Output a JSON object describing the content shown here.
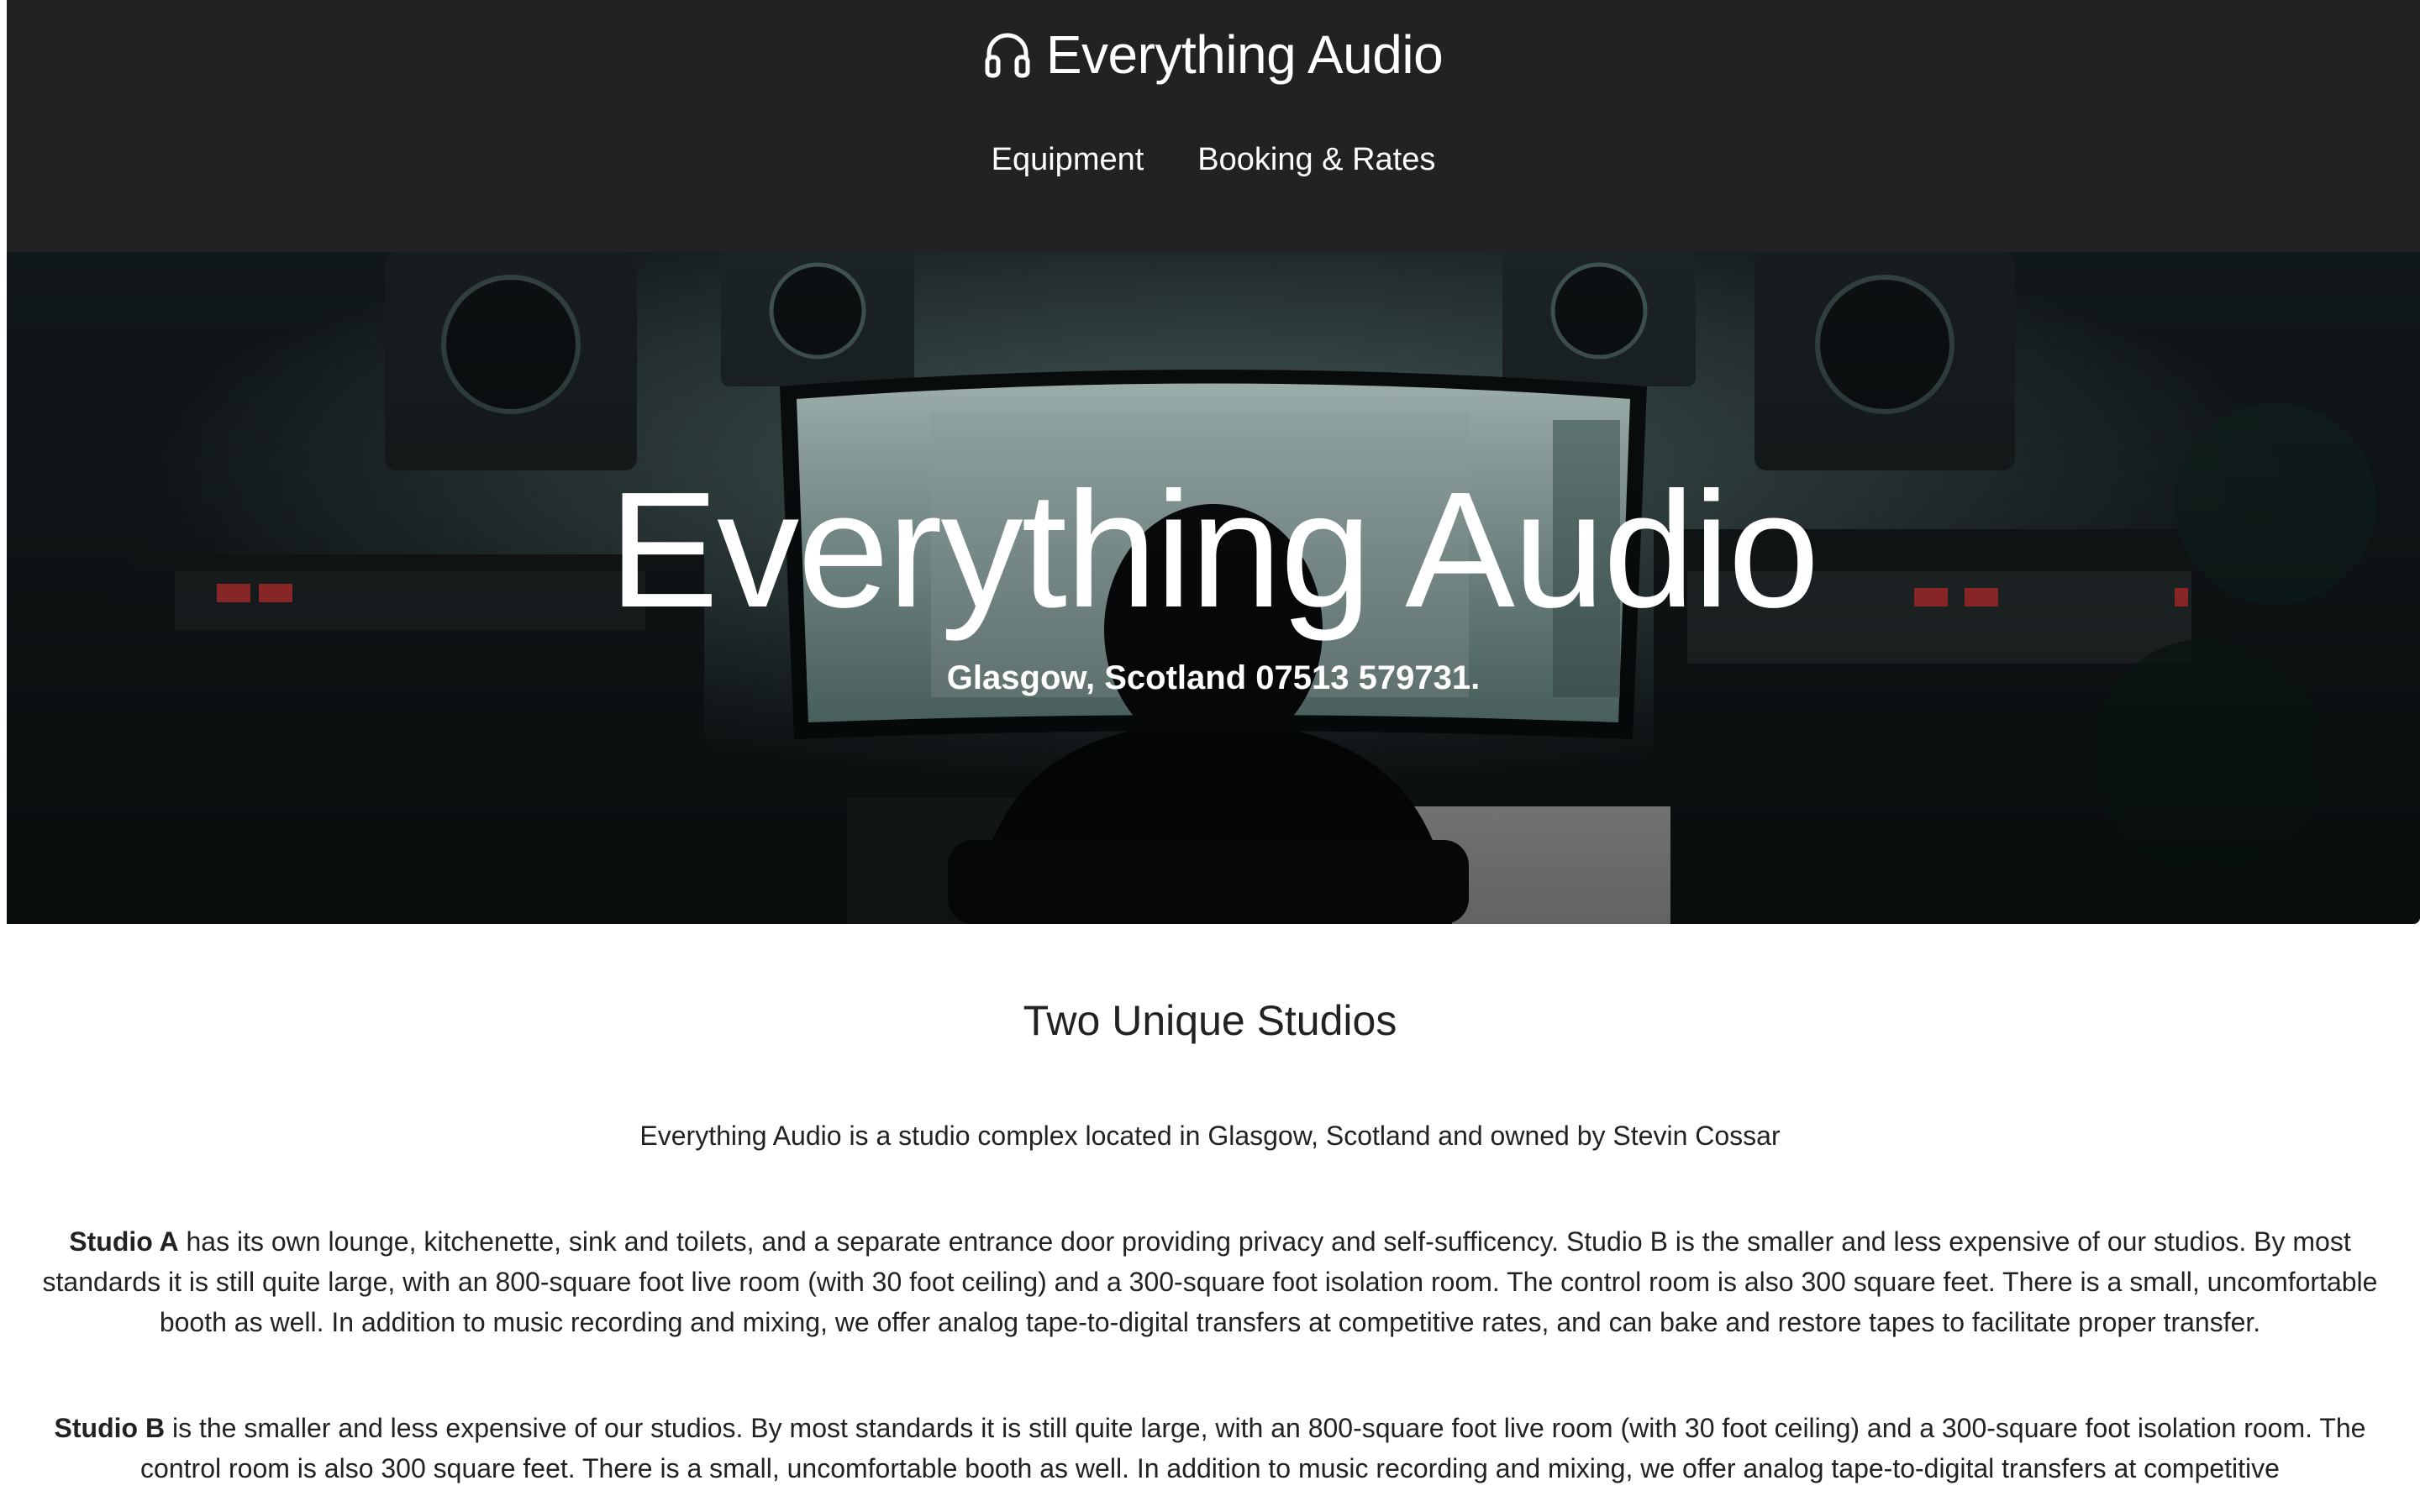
{
  "header": {
    "brand_icon": "headphones-icon",
    "brand_title": "Everything Audio",
    "nav": [
      {
        "label": "Equipment"
      },
      {
        "label": "Booking & Rates"
      }
    ]
  },
  "hero": {
    "title": "Everything Audio",
    "subtitle": "Glasgow, Scotland 07513 579731.",
    "background_description_colors": {
      "accent": "#3a5a58",
      "dark": "#0d1214"
    }
  },
  "main": {
    "section_title": "Two Unique Studios",
    "intro": "Everything Audio is a studio complex located in Glasgow, Scotland and owned by Stevin Cossar",
    "studios": [
      {
        "name": "Studio A",
        "text": " has its own lounge, kitchenette, sink and toilets, and a separate entrance door providing privacy and self-sufficency. Studio B is the smaller and less expensive of our studios. By most standards it is still quite large, with an 800-square foot live room (with 30 foot ceiling) and a 300-square foot isolation room. The control room is also 300 square feet. There is a small, uncomfortable booth as well. In addition to music recording and mixing, we offer analog tape-to-digital transfers at competitive rates, and can bake and restore tapes to facilitate proper transfer."
      },
      {
        "name": "Studio B",
        "text": " is the smaller and less expensive of our studios. By most standards it is still quite large, with an 800-square foot live room (with 30 foot ceiling) and a 300-square foot isolation room. The control room is also 300 square feet. There is a small, uncomfortable booth as well. In addition to music recording and mixing, we offer analog tape-to-digital transfers at competitive"
      }
    ]
  },
  "colors": {
    "header_bg": "#222222",
    "text": "#222222",
    "background": "#ffffff"
  }
}
